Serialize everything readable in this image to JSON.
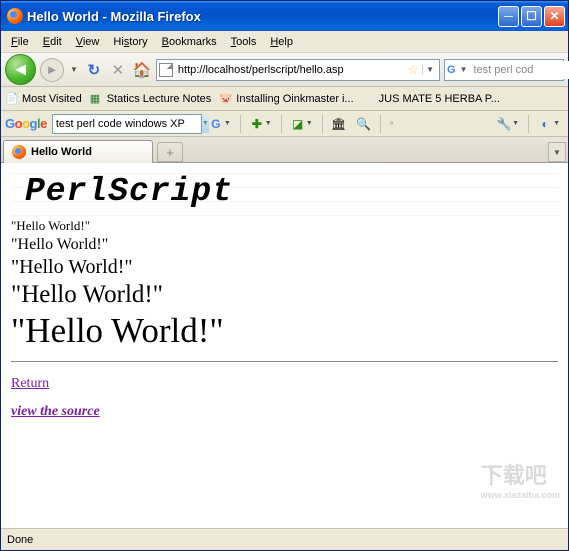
{
  "window": {
    "title": "Hello World - Mozilla Firefox"
  },
  "menu": {
    "file": "File",
    "edit": "Edit",
    "view": "View",
    "history": "History",
    "bookmarks": "Bookmarks",
    "tools": "Tools",
    "help": "Help"
  },
  "nav": {
    "url": "http://localhost/perlscript/hello.asp",
    "search_placeholder": "test perl cod"
  },
  "bookmarks": {
    "b1": "Most Visited",
    "b2": "Statics Lecture Notes",
    "b3": "Installing Oinkmaster i...",
    "b4": "JUS MATE 5 HERBA P..."
  },
  "googlebar": {
    "label": "Google",
    "search": "test perl code windows XP"
  },
  "tab": {
    "title": "Hello World"
  },
  "page": {
    "banner": "PerlScript",
    "hw": "\"Hello World!\"",
    "return": "Return",
    "viewsrc": "view the source"
  },
  "status": {
    "text": "Done"
  },
  "watermark": {
    "big": "下载吧",
    "url": "www.xiazaiba.com"
  }
}
